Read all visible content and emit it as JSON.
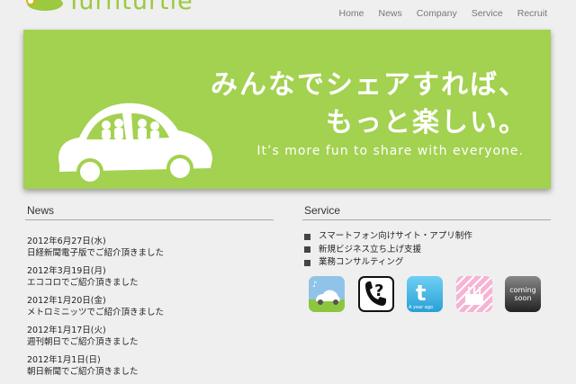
{
  "brand": {
    "name": "Turnturtle"
  },
  "nav": {
    "items": [
      "Home",
      "News",
      "Company",
      "Service",
      "Recruit"
    ]
  },
  "hero": {
    "line1": "みんなでシェアすれば、",
    "line2": "もっと楽しい。",
    "subtitle": "It’s more fun to share with everyone."
  },
  "news": {
    "title": "News",
    "items": [
      {
        "date": "2012年6月27日(水)",
        "text": "日経新聞電子版でご紹介頂きました"
      },
      {
        "date": "2012年3月19日(月)",
        "text": "エココロでご紹介頂きました"
      },
      {
        "date": "2012年1月20日(金)",
        "text": "メトロミニッツでご紹介頂きました"
      },
      {
        "date": "2012年1月17日(火)",
        "text": "週刊朝日でご紹介頂きました"
      },
      {
        "date": "2012年1月1日(日)",
        "text": "朝日新聞でご紹介頂きました"
      }
    ]
  },
  "service": {
    "title": "Service",
    "items": [
      "スマートフォン向けサイト・アプリ制作",
      "新規ビジネス立ち上げ支援",
      "業務コンサルティング"
    ],
    "apps": [
      {
        "icon": "car-app-icon"
      },
      {
        "icon": "phone-question-app-icon"
      },
      {
        "icon": "twitter-a-year-ago-app-icon",
        "label": "A year ago"
      },
      {
        "icon": "birthday-cake-app-icon"
      },
      {
        "icon": "coming-soon-app-icon",
        "label": "coming soon"
      }
    ]
  },
  "colors": {
    "accent": "#a3d150",
    "background": "#efefef"
  }
}
